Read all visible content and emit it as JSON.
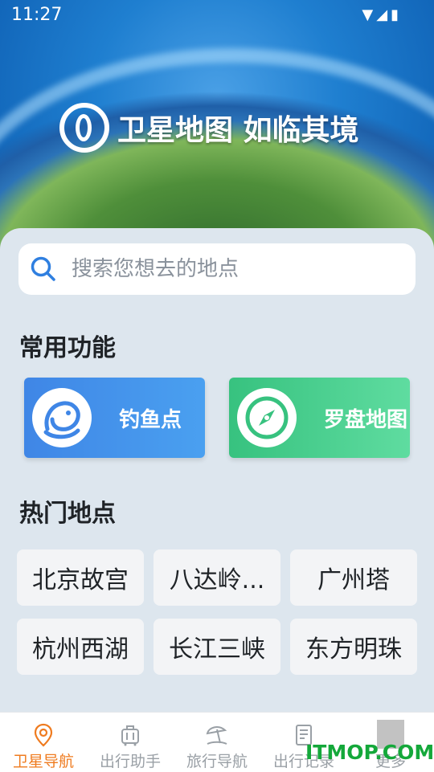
{
  "status_bar": {
    "time": "11:27",
    "icons": [
      "wifi-icon",
      "signal-icon",
      "battery-icon"
    ]
  },
  "hero": {
    "slogan": "卫星地图 如临其境"
  },
  "search": {
    "placeholder": "搜索您想去的地点"
  },
  "features": {
    "title": "常用功能",
    "items": [
      {
        "label": "钓鱼点",
        "icon": "fish-icon",
        "color": "#3f86e6"
      },
      {
        "label": "罗盘地图",
        "icon": "compass-icon",
        "color": "#37c27f"
      }
    ]
  },
  "hot_places": {
    "title": "热门地点",
    "items": [
      "北京故宫",
      "八达岭...",
      "广州塔",
      "杭州西湖",
      "长江三峡",
      "东方明珠"
    ]
  },
  "nav": {
    "items": [
      {
        "label": "卫星导航",
        "icon": "location-pin-icon",
        "active": true
      },
      {
        "label": "出行助手",
        "icon": "luggage-icon",
        "active": false
      },
      {
        "label": "旅行导航",
        "icon": "beach-umbrella-icon",
        "active": false
      },
      {
        "label": "出行记录",
        "icon": "notebook-icon",
        "active": false
      },
      {
        "label": "更多",
        "icon": "more-icon",
        "active": false
      }
    ]
  },
  "watermark": "ITMOP.COM",
  "colors": {
    "accent": "#ef7b1f",
    "nav_inactive": "#9aa0a6",
    "watermark": "#14a83a"
  }
}
